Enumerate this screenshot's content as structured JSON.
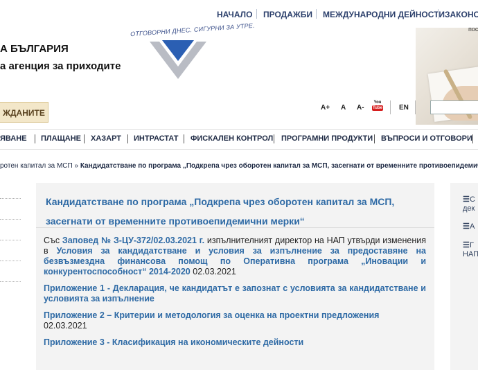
{
  "top_nav": {
    "items": [
      "НАЧАЛО",
      "ПРОДАЖБИ",
      "МЕЖДУНАРОДНИ ДЕЙНОСТИ",
      "ЗАКОНО"
    ],
    "partial_right": "пос"
  },
  "header": {
    "tagline": "ОТГОВОРНИ ДНЕС. СИГУРНИ ЗА УТРЕ.",
    "org_line1": "А БЪЛГАРИЯ",
    "org_line2": "а агенция за приходите",
    "citizens_button": "ЖДАНИТЕ",
    "accent_color": "#2b5fb3",
    "tools": {
      "font_increase": "A+",
      "font_normal": "A",
      "font_decrease": "A-",
      "youtube_you": "You",
      "youtube_tube": "Tube",
      "language": "EN"
    }
  },
  "main_nav": {
    "items": [
      "ЯВАНЕ",
      "ПЛАЩАНЕ",
      "ХАЗАРТ",
      "ИНТРАСТАТ",
      "ФИСКАЛЕН КОНТРОЛ",
      "ПРОГРАМНИ ПРОДУКТИ",
      "ВЪПРОСИ И ОТГОВОРИ"
    ]
  },
  "breadcrumb": {
    "parent": "ротен капитал за МСП",
    "separator": "»",
    "current": "Кандидатстване по програма „Подкрепа чрез оборотен капитал за МСП, засегнати от временните противоепидемич"
  },
  "article": {
    "title_line1": "Кандидатстване по програма „Подкрепа чрез оборотен капитал за МСП,",
    "title_line2": "засегнати от временните противоепидемични мерки“",
    "p1": {
      "t1": "Със ",
      "link1": "Заповед № З-ЦУ-372/02.03.2021 г.",
      "t2": " изпълнителният директор на НАП утвърди изменения в ",
      "link2": "Условия за кандидатстване и условия за изпълнение за предоставяне на безвъзмездна финансова помощ по Оперативна програма „Иновации и конкурентоспособност“ 2014-2020",
      "t3": " 02.03.2021"
    },
    "p2": {
      "link": "Приложение 1 - Декларация, че кандидатът е запознат с условията за кандидатстване и условията за изпълнение"
    },
    "p3": {
      "link": "Приложение 2 – Критерии и методология за оценка на проектни предложения",
      "date": "02.03.2021"
    },
    "p4": {
      "link": "Приложение 3 - Класификация на икономическите дейности"
    },
    "link_color": "#2e6aa5"
  },
  "right_sidebar": {
    "items": [
      {
        "icon": "☰",
        "line1": "С",
        "line2": "дек"
      },
      {
        "icon": "☰",
        "line1": "А",
        "line2": ""
      },
      {
        "icon": "☰",
        "line1": "Г",
        "line2": "НАП"
      }
    ]
  }
}
